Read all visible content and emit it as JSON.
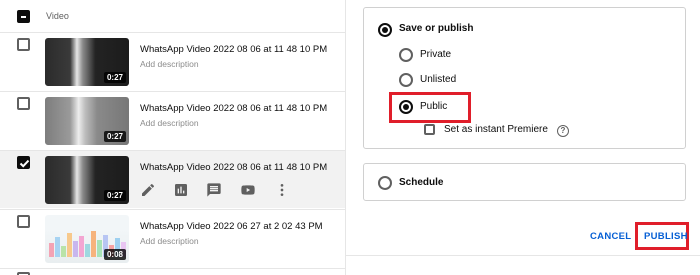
{
  "list": {
    "column_header": "Video",
    "rows": [
      {
        "title": "WhatsApp Video 2022 08 06 at 11 48 10 PM",
        "description": "Add description",
        "duration": "0:27",
        "checked": false
      },
      {
        "title": "WhatsApp Video 2022 08 06 at 11 48 10 PM",
        "description": "Add description",
        "duration": "0:27",
        "checked": false
      },
      {
        "title": "WhatsApp Video 2022 08 06 at 11 48 10 PM",
        "description": "",
        "duration": "0:27",
        "checked": true
      },
      {
        "title": "WhatsApp Video 2022 06 27 at 2 02 43 PM",
        "description": "Add description",
        "duration": "0:08",
        "checked": false
      }
    ],
    "row_actions": [
      "edit-icon",
      "analytics-icon",
      "comments-icon",
      "youtube-icon",
      "more-vert-icon"
    ]
  },
  "panel": {
    "save_or_publish": "Save or publish",
    "private": "Private",
    "unlisted": "Unlisted",
    "public": "Public",
    "premiere": "Set as instant Premiere",
    "schedule": "Schedule",
    "selected_visibility": "Public",
    "cancel": "CANCEL",
    "publish": "PUBLISH",
    "accent_color": "#065fd4",
    "highlight_color": "#e01e2a"
  }
}
